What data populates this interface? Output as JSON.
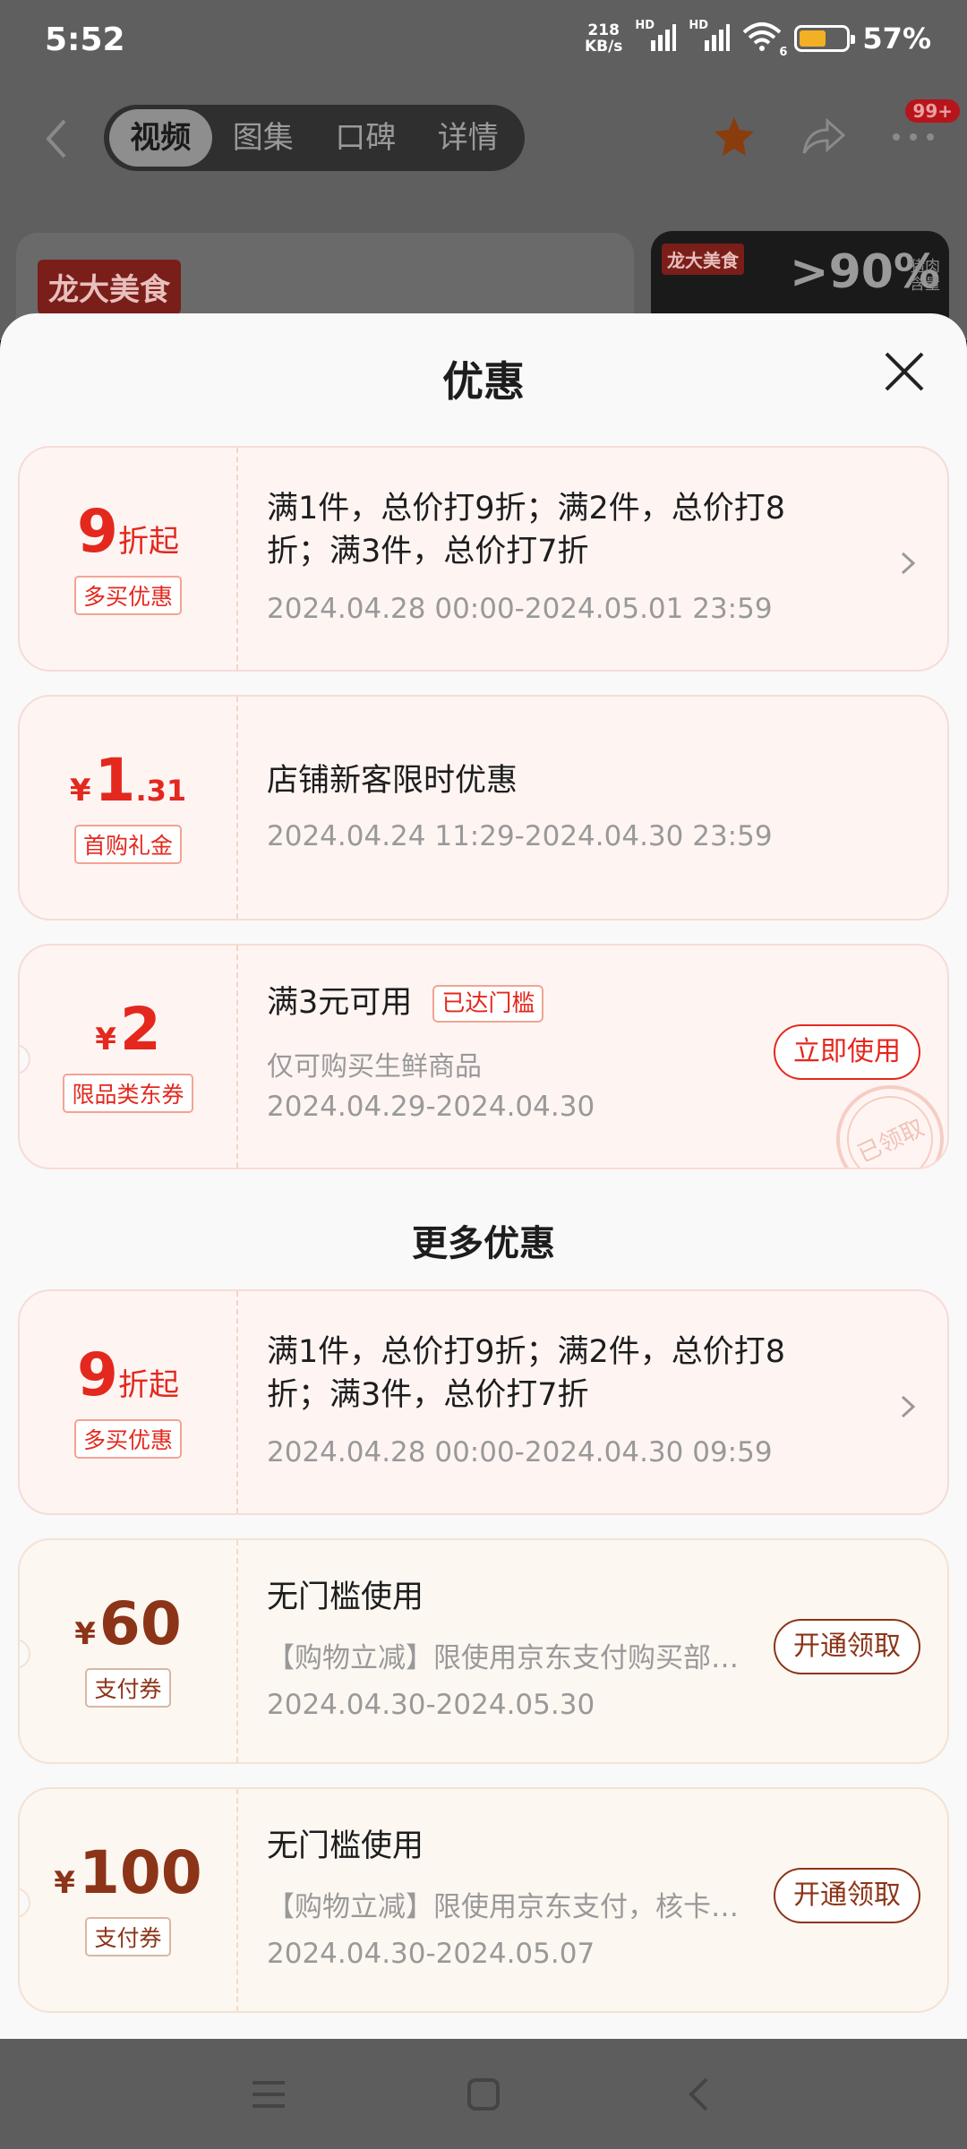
{
  "status_bar": {
    "time": "5:52",
    "net_speed_value": "218",
    "net_speed_unit": "KB/s",
    "hd1": "HD",
    "hd2": "HD",
    "wifi_badge": "6",
    "battery_pct": "57%",
    "battery_level": 0.57
  },
  "background": {
    "tabs": [
      "视频",
      "图集",
      "口碑",
      "详情"
    ],
    "active_tab": 0,
    "badge": "99+",
    "logo_text": "龙大美食",
    "right_card": {
      "logo": "龙大美食",
      "pct": ">90%",
      "meat_l1": "猪肉",
      "meat_l2": "含量"
    }
  },
  "sheet": {
    "title": "优惠",
    "coupons": [
      {
        "amount": "9",
        "amount_suffix": "折起",
        "tag": "多买优惠",
        "main": "满1件，总价打9折；满2件，总价打8折；满3件，总价打7折",
        "date": "2024.04.28 00:00-2024.05.01 23:59"
      },
      {
        "currency": "¥",
        "amount": "1",
        "decimal": ".31",
        "tag": "首购礼金",
        "main": "店铺新客限时优惠",
        "date": "2024.04.24 11:29-2024.04.30 23:59"
      },
      {
        "currency": "¥",
        "amount": "2",
        "tag": "限品类东券",
        "main": "满3元可用",
        "status": "已达门槛",
        "sub": "仅可购买生鲜商品",
        "date": "2024.04.29-2024.04.30",
        "button": "立即使用",
        "stamp": "已领取"
      }
    ],
    "more_title": "更多优惠",
    "more_coupons": [
      {
        "amount": "9",
        "amount_suffix": "折起",
        "tag": "多买优惠",
        "main": "满1件，总价打9折；满2件，总价打8折；满3件，总价打7折",
        "date": "2024.04.28 00:00-2024.04.30 09:59"
      },
      {
        "currency": "¥",
        "amount": "60",
        "tag": "支付券",
        "main": "无门槛使用",
        "desc": "【购物立减】限使用京东支付购买部分商品",
        "date": "2024.04.30-2024.05.30",
        "button": "开通领取"
      },
      {
        "currency": "¥",
        "amount": "100",
        "tag": "支付券",
        "main": "无门槛使用",
        "desc": "【购物立减】限使用京东支付，核卡后可用",
        "date": "2024.04.30-2024.05.07",
        "button": "开通领取"
      }
    ]
  },
  "colors": {
    "accent_red": "#e4281e",
    "brown": "#8c3418",
    "sheet_bg": "#f9f9f9"
  }
}
